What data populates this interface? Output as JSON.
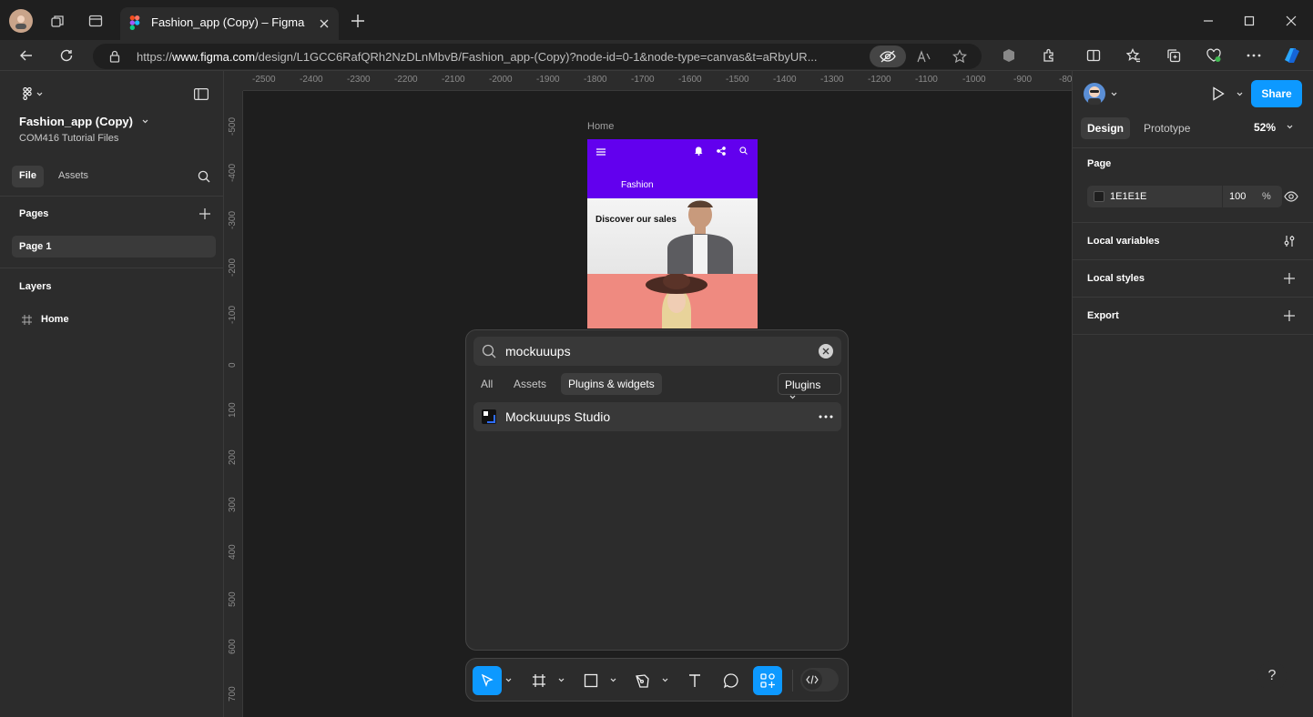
{
  "browser": {
    "tab_title": "Fashion_app (Copy) – Figma",
    "url_prefix": "https://",
    "url_host": "www.figma.com",
    "url_path": "/design/L1GCC6RafQRh2NzDLnMbvB/Fashion_app-(Copy)?node-id=0-1&node-type=canvas&t=aRbyUR..."
  },
  "left_panel": {
    "file_title": "Fashion_app (Copy)",
    "project": "COM416 Tutorial Files",
    "tabs": [
      "File",
      "Assets"
    ],
    "pages_header": "Pages",
    "pages": [
      "Page 1"
    ],
    "layers_header": "Layers",
    "layers": [
      "Home"
    ]
  },
  "ruler": {
    "top_ticks": [
      "-2500",
      "-2400",
      "-2300",
      "-2200",
      "-2100",
      "-2000",
      "-1900",
      "-1800",
      "-1700",
      "-1600",
      "-1500",
      "-1400",
      "-1300",
      "-1200",
      "-1100",
      "-1000",
      "-900",
      "-80"
    ],
    "left_ticks": [
      "-500",
      "-400",
      "-300",
      "-200",
      "-100",
      "0",
      "100",
      "200",
      "300",
      "400",
      "500",
      "600",
      "700"
    ]
  },
  "canvas": {
    "frame_label": "Home",
    "phone": {
      "header_title": "Fashion",
      "hero_text": "Discover our sales"
    }
  },
  "quick_actions": {
    "search_value": "mockuuups",
    "tabs": [
      "All",
      "Assets",
      "Plugins & widgets"
    ],
    "active_tab": "Plugins & widgets",
    "filter_label": "Plugins",
    "results": [
      "Mockuuups Studio"
    ]
  },
  "right_panel": {
    "tabs": [
      "Design",
      "Prototype"
    ],
    "zoom": "52%",
    "share_label": "Share",
    "page_header": "Page",
    "bg_color_hex": "1E1E1E",
    "bg_opacity": "100",
    "opacity_unit": "%",
    "sections": [
      "Local variables",
      "Local styles",
      "Export"
    ]
  },
  "help_label": "?",
  "colors": {
    "accent": "#0d99ff",
    "phone_primary": "#6200ee",
    "canvas_bg": "#1e1e1e"
  }
}
